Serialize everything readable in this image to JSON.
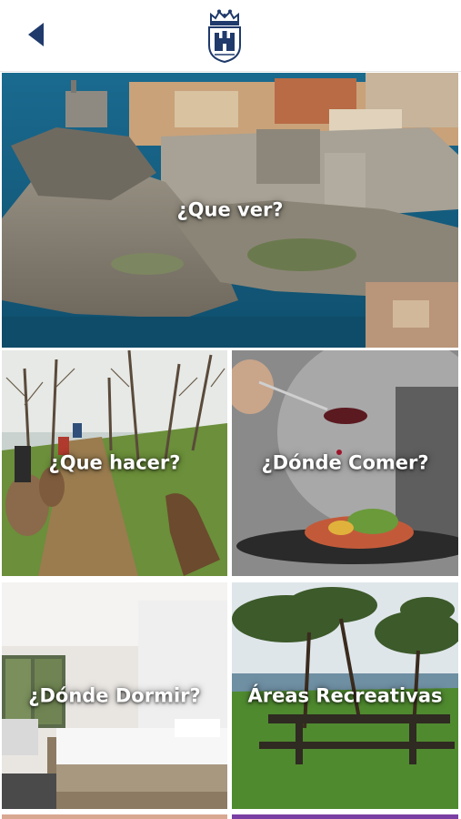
{
  "header": {
    "back_icon": "chevron-left-icon",
    "logo_icon": "crowned-shield-emblem-icon"
  },
  "colors": {
    "accent": "#1f3a6b",
    "tile_text": "#ffffff",
    "background": "#ffffff",
    "partial_tile_left": "#d9a890",
    "partial_tile_right": "#7a3fa3"
  },
  "tiles": [
    {
      "label": "¿Que ver?"
    },
    {
      "label": "¿Que hacer?"
    },
    {
      "label": "¿Dónde Comer?"
    },
    {
      "label": "¿Dónde Dormir?"
    },
    {
      "label": "Áreas Recreativas"
    }
  ]
}
